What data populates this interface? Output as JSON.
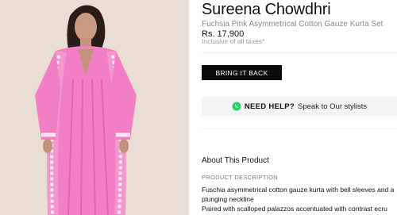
{
  "product": {
    "brand": "Sureena Chowdhri",
    "name": "Fuchsia Pink Asymmetrical Cotton Gauze Kurta Set",
    "price": "Rs. 17,900",
    "tax_note": "Inclusive of all taxes*"
  },
  "cta": {
    "label": "BRING IT BACK"
  },
  "help": {
    "icon": "whatsapp-icon",
    "title": "NEED HELP?",
    "link_text": "Speak to Our stylists"
  },
  "about": {
    "title": "About This Product",
    "description_label": "PRODUCT DESCRIPTION",
    "description_lines": [
      "Fuschia asymmetrical cotton gauze kurta with bell sleeves and a",
      "plunging neckline",
      "Paired with scalloped palazzos accentuated with contrast ecru"
    ]
  },
  "colors": {
    "garment_pink": "#f27fc3",
    "image_background": "#e9ddd4",
    "cta_background": "#0b0b0b",
    "whatsapp_green": "#25d366"
  }
}
